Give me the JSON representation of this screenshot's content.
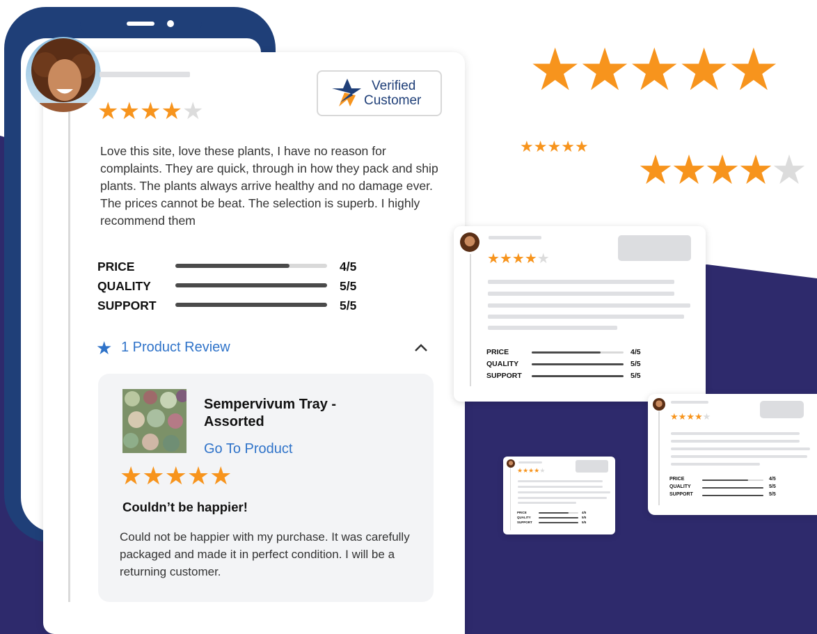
{
  "colors": {
    "navy": "#1f3f78",
    "purple": "#2e2a6c",
    "star_orange": "#f7941d",
    "star_gray": "#dcdcdc",
    "link_blue": "#2f73c9",
    "panel_gray": "#f3f4f6"
  },
  "icons": {
    "star": "★",
    "chevron_up": "⌃",
    "verified_mark": "verified-star-icon"
  },
  "badge": {
    "line1": "Verified",
    "line2": "Customer"
  },
  "review": {
    "rating": 4,
    "rating_max": 5,
    "body": "Love this site, love these plants, I have no reason for complaints. They are quick, through in how they pack and ship plants.  The plants always arrive healthy and no damage ever. The prices cannot be beat. The selection is superb. I highly recommend them",
    "metrics": [
      {
        "label": "PRICE",
        "value": "4/5",
        "level": 0.75
      },
      {
        "label": "QUALITY",
        "value": "5/5",
        "level": 1.0
      },
      {
        "label": "SUPPORT",
        "value": "5/5",
        "level": 1.0
      }
    ]
  },
  "product_review": {
    "toggle_label": "1 Product Review",
    "product_name": "Sempervivum Tray - Assorted",
    "link_label": "Go To Product",
    "rating": 5,
    "headline": "Couldn’t be happier!",
    "body": "Could not be happier with my purchase. It was carefully packaged and made it in perfect condition.  I will be a returning customer."
  },
  "decor": {
    "big_stars": 5,
    "small_stars": 5,
    "mid_stars_filled": 4,
    "mid_stars_total": 5
  },
  "mini_cards": [
    {
      "rating": 4,
      "metrics": [
        {
          "label": "PRICE",
          "value": "4/5",
          "level": 0.75
        },
        {
          "label": "QUALITY",
          "value": "5/5",
          "level": 1.0
        },
        {
          "label": "SUPPORT",
          "value": "5/5",
          "level": 1.0
        }
      ]
    },
    {
      "rating": 4,
      "metrics": [
        {
          "label": "PRICE",
          "value": "4/5",
          "level": 0.75
        },
        {
          "label": "QUALITY",
          "value": "5/5",
          "level": 1.0
        },
        {
          "label": "SUPPORT",
          "value": "5/5",
          "level": 1.0
        }
      ]
    },
    {
      "rating": 4,
      "metrics": [
        {
          "label": "PRICE",
          "value": "4/5",
          "level": 0.75
        },
        {
          "label": "QUALITY",
          "value": "5/5",
          "level": 1.0
        },
        {
          "label": "SUPPORT",
          "value": "5/5",
          "level": 1.0
        }
      ]
    }
  ]
}
